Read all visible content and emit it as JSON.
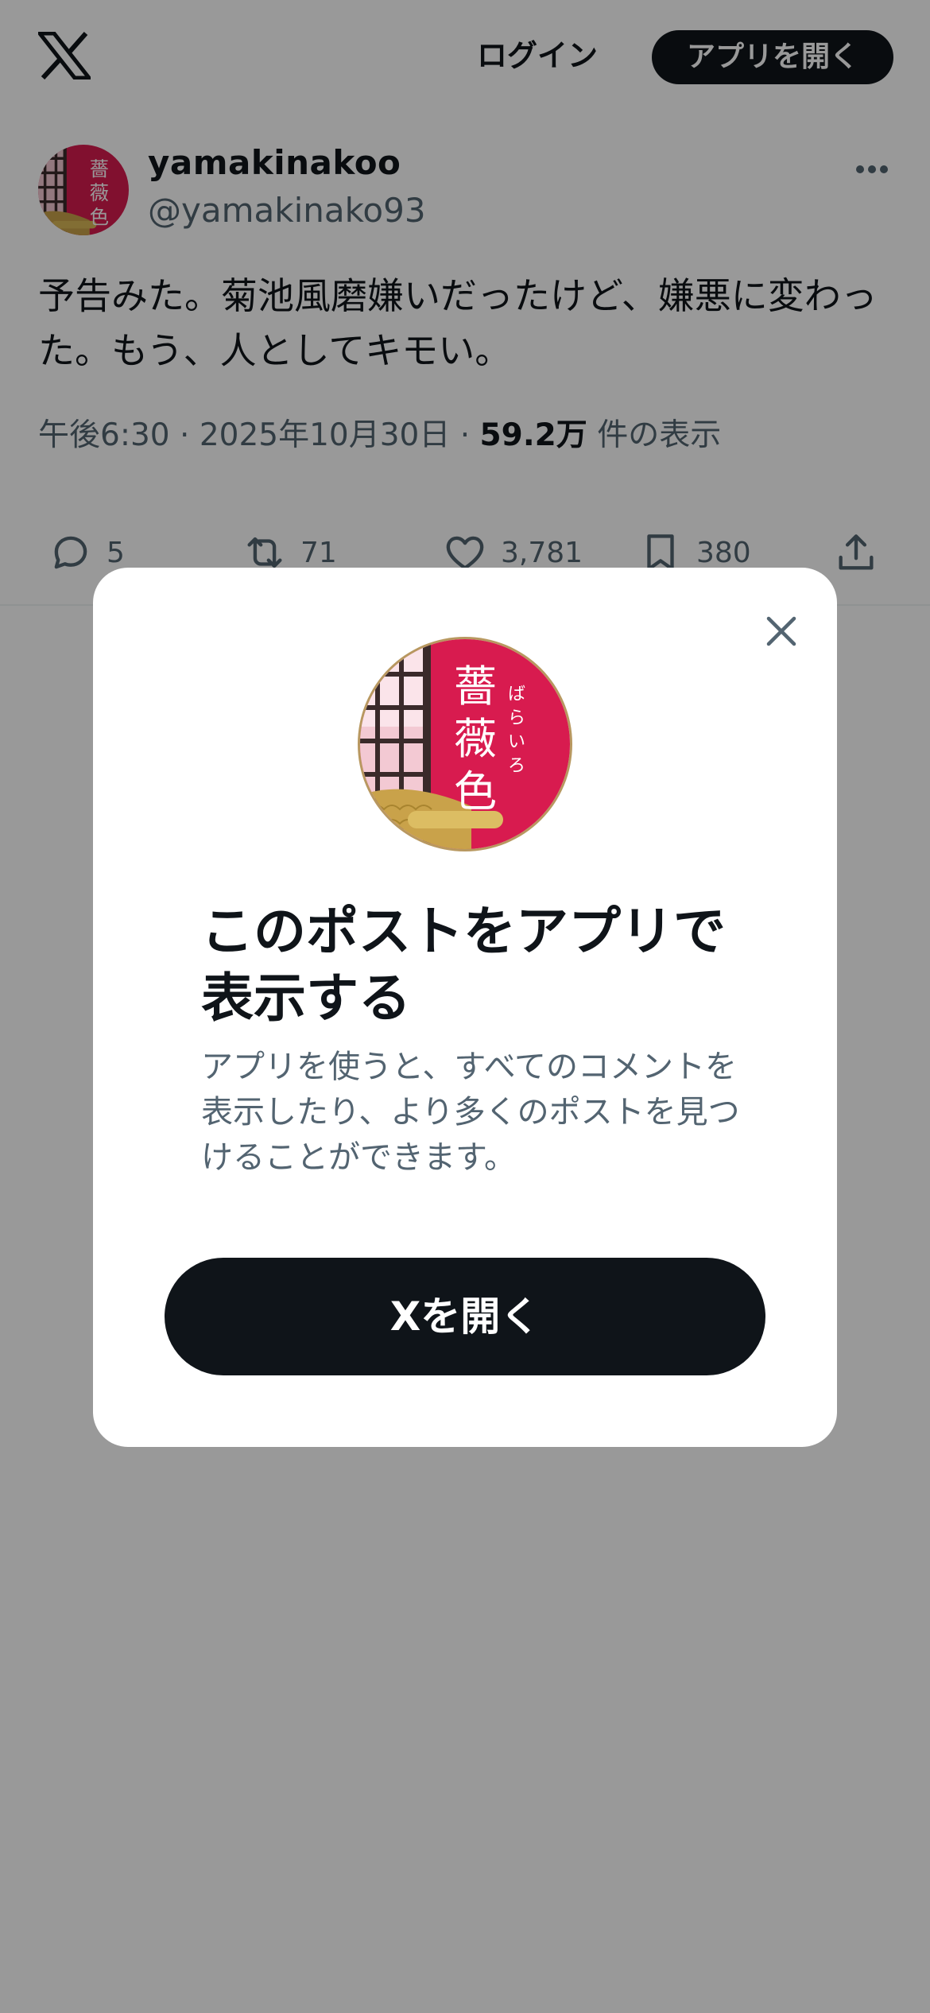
{
  "header": {
    "logo_icon": "x-logo-icon",
    "login_label": "ログイン",
    "open_app_label": "アプリを開く"
  },
  "tweet": {
    "display_name": "yamakinakoo",
    "handle": "@yamakinako93",
    "text": "予告みた。菊池風磨嫌いだったけど、嫌悪に変わった。もう、人としてキモい。",
    "time": "午後6:30",
    "date": "2025年10月30日",
    "separator": "·",
    "views_count": "59.2万",
    "views_label": "件の表示",
    "avatar_text": "薔薇色",
    "avatar_ruby": "ばらいろ",
    "actions": {
      "replies": "5",
      "retweets": "71",
      "likes": "3,781",
      "bookmarks": "380"
    }
  },
  "modal": {
    "title": "このポストをアプリで表示する",
    "description": "アプリを使うと、すべてのコメントを表示したり、より多くのポストを見つけることができます。",
    "button_label": "Xを開く",
    "avatar_text": "薔薇色",
    "avatar_ruby": "ばらいろ"
  },
  "colors": {
    "text_primary": "#0f1419",
    "text_secondary": "#536471",
    "overlay": "rgba(0,0,0,0.4)",
    "avatar_crimson": "#d81b4f",
    "avatar_gold": "#c9a24a"
  }
}
